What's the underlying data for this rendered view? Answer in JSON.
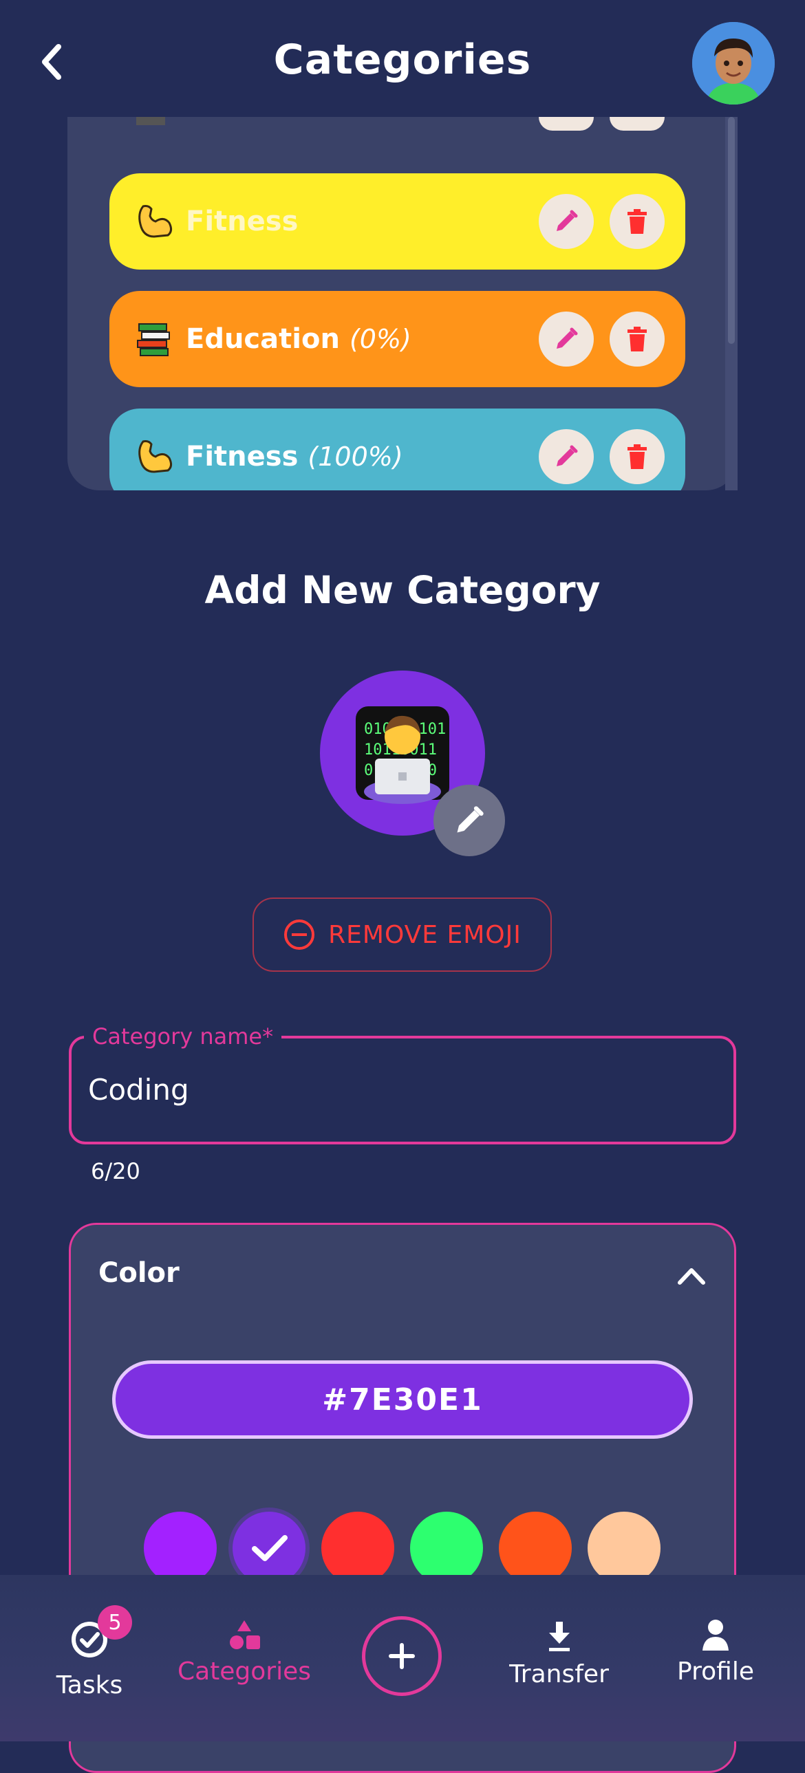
{
  "header": {
    "title": "Categories"
  },
  "categories": [
    {
      "name": "Fitness",
      "percent": "",
      "color": "#ffee2a",
      "emoji": "flexed-biceps"
    },
    {
      "name": "Education",
      "percent": "(0%)",
      "color": "#ff9419",
      "emoji": "books"
    },
    {
      "name": "Fitness",
      "percent": "(100%)",
      "color": "#4fb6cd",
      "emoji": "flexed-biceps"
    }
  ],
  "partial_category_color": "#ff2af2",
  "add_form": {
    "title": "Add New Category",
    "emoji": "technologist",
    "emoji_bg": "#7e30e1",
    "remove_emoji_label": "REMOVE EMOJI",
    "name_label": "Category name*",
    "name_value": "Coding",
    "counter": "6/20",
    "color_section_label": "Color",
    "selected_color": "#7E30E1",
    "swatches": [
      "#a321ff",
      "#7e30e1",
      "#ff2f2f",
      "#2dff6f",
      "#ff531a",
      "#ffc89c"
    ],
    "selected_swatch_index": 1
  },
  "nav": {
    "tasks": "Tasks",
    "tasks_badge": "5",
    "categories": "Categories",
    "transfer": "Transfer",
    "profile": "Profile",
    "active": "categories"
  },
  "colors": {
    "accent": "#e3399b",
    "background": "#232c57",
    "danger": "#ff3a3a"
  }
}
